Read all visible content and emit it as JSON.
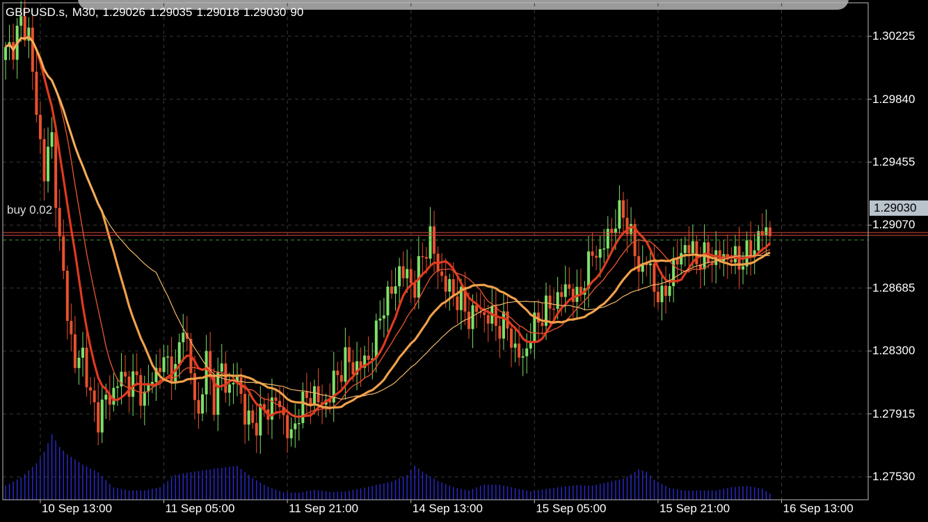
{
  "header": {
    "symbol": "GBPUSD.s,",
    "timeframe": "M30,",
    "open": "1.29026",
    "high": "1.29035",
    "low": "1.29018",
    "close": "1.29030",
    "volume": "90"
  },
  "order": {
    "label": "buy 0.02",
    "price": 1.2902
  },
  "current_price": {
    "label": "1.29030",
    "value": 1.2903
  },
  "colors": {
    "background": "#000000",
    "bull": "#7ee06a",
    "bear": "#e8512e",
    "grid": "#3a3a3a",
    "volume": "#2b2bd6",
    "ma_fast": "#e03a1f",
    "ma_mid": "#e0512f",
    "ma_slow": "#f0a04a",
    "ma_slowest": "#f2b868",
    "order_line": "#d84a3a",
    "bid_line": "#3a9a3a"
  },
  "chart_data": {
    "type": "candlestick",
    "title": "GBPUSD.s, M30",
    "ylim": [
      1.2739,
      1.3043
    ],
    "y_ticks": [
      1.30225,
      1.2984,
      1.29455,
      1.2907,
      1.28685,
      1.283,
      1.27915,
      1.2753
    ],
    "y_tick_labels": [
      "1.30225",
      "1.29840",
      "1.29455",
      "1.29070",
      "1.28685",
      "1.28300",
      "1.27915",
      "1.27530"
    ],
    "x_tick_labels": [
      "10 Sep 13:00",
      "11 Sep 05:00",
      "11 Sep 21:00",
      "14 Sep 13:00",
      "15 Sep 05:00",
      "15 Sep 21:00",
      "16 Sep 13:00"
    ],
    "x_tick_bar_index": [
      9,
      41,
      73,
      105,
      137,
      169,
      201
    ],
    "grid": true,
    "price_path": [
      [
        0,
        1.3012
      ],
      [
        2,
        1.3018
      ],
      [
        4,
        1.303
      ],
      [
        6,
        1.3025
      ],
      [
        8,
        1.2975
      ],
      [
        10,
        1.294
      ],
      [
        12,
        1.296
      ],
      [
        14,
        1.2895
      ],
      [
        16,
        1.2855
      ],
      [
        18,
        1.282
      ],
      [
        20,
        1.283
      ],
      [
        22,
        1.28
      ],
      [
        24,
        1.279
      ],
      [
        26,
        1.28
      ],
      [
        28,
        1.2805
      ],
      [
        30,
        1.2815
      ],
      [
        32,
        1.281
      ],
      [
        34,
        1.2812
      ],
      [
        36,
        1.28
      ],
      [
        38,
        1.2815
      ],
      [
        40,
        1.282
      ],
      [
        42,
        1.2825
      ],
      [
        44,
        1.2815
      ],
      [
        46,
        1.285
      ],
      [
        48,
        1.2815
      ],
      [
        50,
        1.279
      ],
      [
        52,
        1.2825
      ],
      [
        54,
        1.28
      ],
      [
        56,
        1.282
      ],
      [
        58,
        1.2805
      ],
      [
        60,
        1.2815
      ],
      [
        62,
        1.279
      ],
      [
        64,
        1.2785
      ],
      [
        66,
        1.279
      ],
      [
        68,
        1.2795
      ],
      [
        70,
        1.28
      ],
      [
        72,
        1.279
      ],
      [
        74,
        1.2775
      ],
      [
        76,
        1.2795
      ],
      [
        78,
        1.28
      ],
      [
        80,
        1.2805
      ],
      [
        82,
        1.2795
      ],
      [
        84,
        1.2805
      ],
      [
        86,
        1.2815
      ],
      [
        88,
        1.2825
      ],
      [
        90,
        1.282
      ],
      [
        92,
        1.2822
      ],
      [
        94,
        1.2825
      ],
      [
        96,
        1.284
      ],
      [
        98,
        1.286
      ],
      [
        100,
        1.2865
      ],
      [
        102,
        1.288
      ],
      [
        104,
        1.2875
      ],
      [
        106,
        1.287
      ],
      [
        108,
        1.2888
      ],
      [
        110,
        1.29
      ],
      [
        112,
        1.288
      ],
      [
        114,
        1.287
      ],
      [
        116,
        1.2865
      ],
      [
        118,
        1.286
      ],
      [
        120,
        1.285
      ],
      [
        122,
        1.2855
      ],
      [
        124,
        1.2852
      ],
      [
        126,
        1.285
      ],
      [
        128,
        1.2845
      ],
      [
        130,
        1.2845
      ],
      [
        132,
        1.283
      ],
      [
        134,
        1.2825
      ],
      [
        136,
        1.284
      ],
      [
        138,
        1.285
      ],
      [
        140,
        1.2855
      ],
      [
        142,
        1.286
      ],
      [
        144,
        1.2865
      ],
      [
        146,
        1.287
      ],
      [
        148,
        1.286
      ],
      [
        150,
        1.2875
      ],
      [
        152,
        1.289
      ],
      [
        154,
        1.289
      ],
      [
        156,
        1.29
      ],
      [
        158,
        1.291
      ],
      [
        160,
        1.2915
      ],
      [
        162,
        1.29
      ],
      [
        164,
        1.288
      ],
      [
        166,
        1.2885
      ],
      [
        168,
        1.287
      ],
      [
        170,
        1.286
      ],
      [
        172,
        1.2875
      ],
      [
        174,
        1.2885
      ],
      [
        176,
        1.2895
      ],
      [
        178,
        1.289
      ],
      [
        180,
        1.2885
      ],
      [
        182,
        1.2888
      ],
      [
        184,
        1.2886
      ],
      [
        186,
        1.2888
      ],
      [
        188,
        1.2887
      ],
      [
        190,
        1.2885
      ],
      [
        192,
        1.2888
      ],
      [
        194,
        1.2895
      ],
      [
        196,
        1.2903
      ],
      [
        198,
        1.2903
      ]
    ],
    "volume_profile": [
      [
        0,
        30
      ],
      [
        4,
        45
      ],
      [
        8,
        70
      ],
      [
        10,
        90
      ],
      [
        12,
        120
      ],
      [
        14,
        95
      ],
      [
        16,
        80
      ],
      [
        20,
        60
      ],
      [
        24,
        45
      ],
      [
        28,
        20
      ],
      [
        32,
        15
      ],
      [
        36,
        15
      ],
      [
        40,
        20
      ],
      [
        44,
        40
      ],
      [
        48,
        45
      ],
      [
        52,
        50
      ],
      [
        56,
        55
      ],
      [
        60,
        60
      ],
      [
        64,
        40
      ],
      [
        68,
        25
      ],
      [
        72,
        15
      ],
      [
        76,
        15
      ],
      [
        80,
        20
      ],
      [
        84,
        15
      ],
      [
        88,
        15
      ],
      [
        92,
        20
      ],
      [
        96,
        25
      ],
      [
        100,
        30
      ],
      [
        104,
        40
      ],
      [
        106,
        55
      ],
      [
        108,
        45
      ],
      [
        112,
        30
      ],
      [
        116,
        20
      ],
      [
        120,
        15
      ],
      [
        124,
        25
      ],
      [
        128,
        25
      ],
      [
        132,
        20
      ],
      [
        136,
        15
      ],
      [
        140,
        20
      ],
      [
        144,
        25
      ],
      [
        148,
        30
      ],
      [
        152,
        30
      ],
      [
        156,
        35
      ],
      [
        160,
        40
      ],
      [
        164,
        55
      ],
      [
        166,
        50
      ],
      [
        168,
        35
      ],
      [
        172,
        20
      ],
      [
        176,
        15
      ],
      [
        180,
        15
      ],
      [
        184,
        15
      ],
      [
        188,
        20
      ],
      [
        192,
        22
      ],
      [
        196,
        18
      ],
      [
        198,
        10
      ]
    ],
    "moving_averages": [
      {
        "key": "ma_fast",
        "period": 8,
        "width": 3.2
      },
      {
        "key": "ma_mid",
        "period": 14,
        "width": 1.4
      },
      {
        "key": "ma_slow",
        "period": 26,
        "width": 3.2
      },
      {
        "key": "ma_slowest",
        "period": 40,
        "width": 1.2
      }
    ]
  }
}
